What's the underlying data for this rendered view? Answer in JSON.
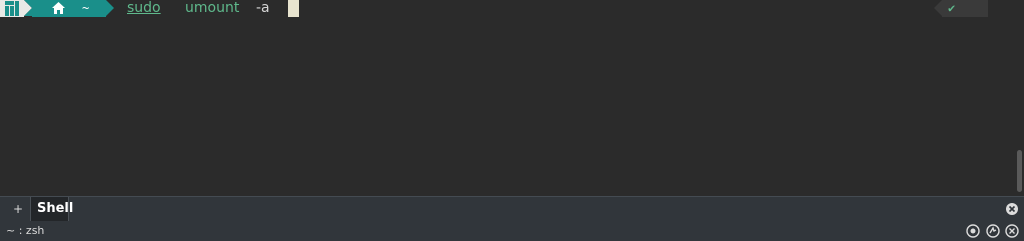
{
  "prompt": {
    "os_icon": "manjaro-logo-icon",
    "home_icon": "home-icon",
    "directory": "~",
    "command": "sudo",
    "subcommand": "umount",
    "argument": "-a",
    "status_mark": "✔"
  },
  "tabbar": {
    "new_tab_label": "+",
    "tabs": [
      {
        "label": "Shell",
        "active": true
      }
    ]
  },
  "statusbar": {
    "text": "~ : zsh",
    "icons": [
      "monitor-activity-icon",
      "monitor-silence-icon",
      "close-icon"
    ]
  },
  "colors": {
    "background": "#2b2b2b",
    "accent": "#1a8f8a",
    "command_green": "#5fb98c",
    "cursor": "#e8e4cf"
  }
}
